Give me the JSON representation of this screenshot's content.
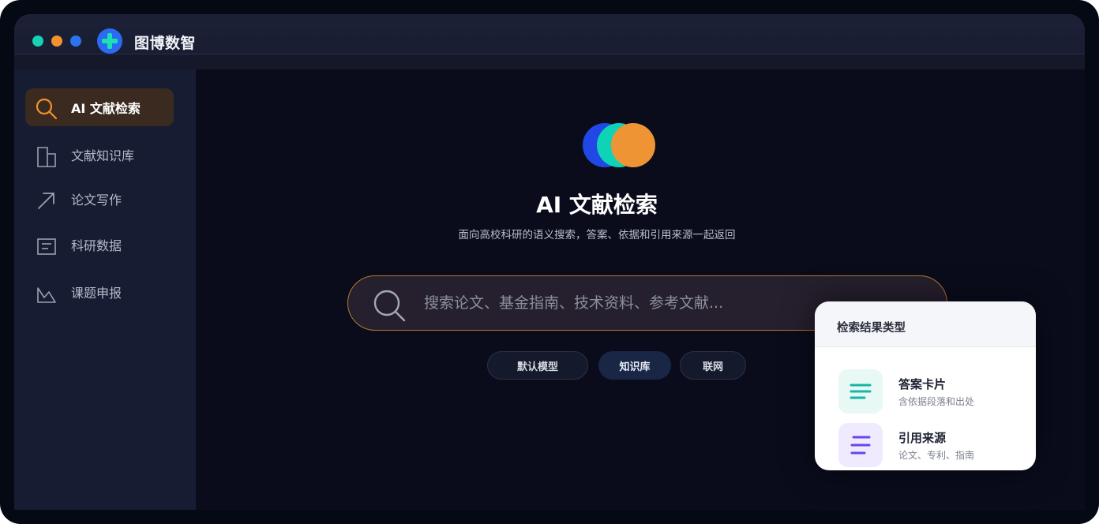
{
  "window": {
    "title": "图博数智",
    "dot_colors": [
      "#16d1b3",
      "#f1922f",
      "#2b73f0"
    ]
  },
  "sidebar": {
    "items": [
      {
        "label": "AI 文献检索",
        "icon": "search-icon",
        "active": true
      },
      {
        "label": "文献知识库",
        "icon": "book-icon",
        "active": false
      },
      {
        "label": "论文写作",
        "icon": "arrow-up-right-icon",
        "active": false
      },
      {
        "label": "科研数据",
        "icon": "document-icon",
        "active": false
      },
      {
        "label": "课题申报",
        "icon": "chart-peak-icon",
        "active": false
      }
    ]
  },
  "main": {
    "title": "AI 文献检索",
    "subtitle": "面向高校科研的语义搜索，答案、依据和引用来源一起返回",
    "search": {
      "placeholder": "搜索论文、基金指南、技术资料、参考文献..."
    },
    "chips": [
      {
        "label": "默认模型",
        "active": false
      },
      {
        "label": "知识库",
        "active": true
      },
      {
        "label": "联网",
        "active": false
      }
    ]
  },
  "popup": {
    "title": "检索结果类型",
    "items": [
      {
        "title": "答案卡片",
        "desc": "含依据段落和出处",
        "icon": "lines-icon",
        "color": "#14b7a4"
      },
      {
        "title": "引用来源",
        "desc": "论文、专利、指南",
        "icon": "list-icon",
        "color": "#6a45f0"
      }
    ]
  },
  "colors": {
    "accent_orange": "#f1922f",
    "accent_blue": "#2b6af2",
    "accent_teal": "#16d1b3"
  }
}
